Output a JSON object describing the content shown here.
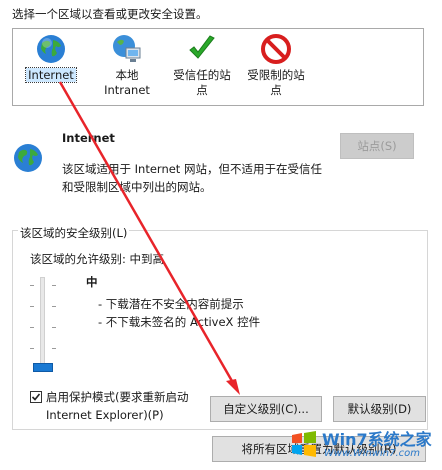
{
  "header": {
    "instruction": "选择一个区域以查看或更改安全设置。"
  },
  "zones": [
    {
      "line1": "Internet",
      "line2": "",
      "icon": "globe-icon",
      "selected": true
    },
    {
      "line1": "本地",
      "line2": "Intranet",
      "icon": "network-computer-icon",
      "selected": false
    },
    {
      "line1": "受信任的站",
      "line2": "点",
      "icon": "green-checkmark-icon",
      "selected": false
    },
    {
      "line1": "受限制的站",
      "line2": "点",
      "icon": "no-entry-icon",
      "selected": false
    }
  ],
  "zone_info": {
    "title": "Internet",
    "desc1": "该区域适用于 Internet 网站，但不适用于在受信任",
    "desc2": "和受限制区域中列出的网站。",
    "sites_button": "站点(S)"
  },
  "security": {
    "group_title": "该区域的安全级别(L)",
    "allowed": "该区域的允许级别: 中到高",
    "level_name": "中",
    "bullets": [
      "- 下载潜在不安全内容前提示",
      "- 不下载未签名的 ActiveX 控件"
    ],
    "protected_mode_line1": "启用保护模式(要求重新启动",
    "protected_mode_line2": "Internet Explorer)(P)",
    "protected_mode_checked": true,
    "custom_level_button": "自定义级别(C)...",
    "default_level_button": "默认级别(D)",
    "reset_all_button": "将所有区域重置为默认级别(R)"
  },
  "watermark": {
    "line1": "Win7系统之家",
    "line2": "Www.Winwin7.com"
  },
  "colors": {
    "accent": "#1979d3",
    "arrow": "#e8242a",
    "selection": "#cde8ff"
  }
}
